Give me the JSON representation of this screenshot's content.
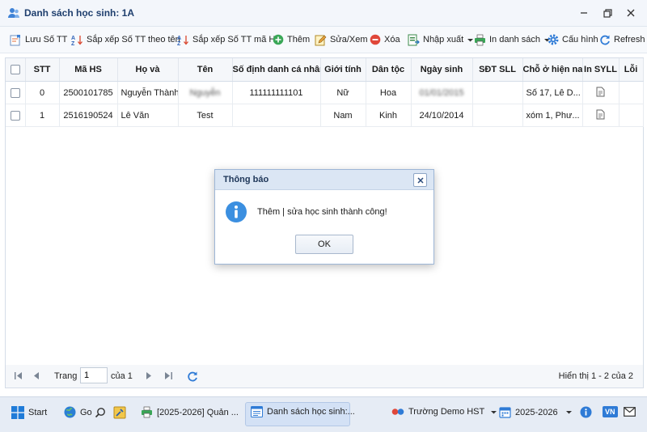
{
  "window": {
    "title": "Danh sách học sinh: 1A"
  },
  "toolbar": {
    "save_order": "Lưu Số TT",
    "sort_by_name": "Sắp xếp Số TT theo tên",
    "sort_by_code": "Sắp xếp Số TT mã HS",
    "add": "Thêm",
    "edit_view": "Sửa/Xem",
    "delete": "Xóa",
    "import_export": "Nhập xuất",
    "print_list": "In danh sách",
    "config": "Cấu hình",
    "refresh": "Refresh"
  },
  "grid": {
    "columns": [
      "STT",
      "Mã HS",
      "Họ và",
      "Tên",
      "Số định danh cá nhân",
      "Giới tính",
      "Dân tộc",
      "Ngày sinh",
      "SĐT SLL",
      "Chỗ ở hiện nay",
      "In SYLL",
      "Lỗi"
    ],
    "rows": [
      {
        "stt": "0",
        "ma_hs": "2500101785",
        "ho": "Nguyễn Thành",
        "ten": "Nguyễn",
        "so_dinh_danh": "111111111101",
        "gioi_tinh": "Nữ",
        "dan_toc": "Hoa",
        "ngay_sinh": "01/01/2015",
        "sdt": "",
        "cho_o": "Số 17, Lê D...",
        "loi": ""
      },
      {
        "stt": "1",
        "ma_hs": "2516190524",
        "ho": "Lê Văn",
        "ten": "Test",
        "so_dinh_danh": "",
        "gioi_tinh": "Nam",
        "dan_toc": "Kinh",
        "ngay_sinh": "24/10/2014",
        "sdt": "",
        "cho_o": "xóm 1, Phư...",
        "loi": ""
      }
    ]
  },
  "pager": {
    "page_label": "Trang",
    "page_value": "1",
    "of_label": "của 1",
    "summary": "Hiển thị 1 - 2 của 2"
  },
  "dialog": {
    "title": "Thông báo",
    "message": "Thêm | sửa học sinh thành công!",
    "ok": "OK"
  },
  "taskbar": {
    "start": "Start",
    "go": "Go",
    "app1": "[2025-2026] Quản ...",
    "app2": "Danh sách học sinh:...",
    "school": "Trường Demo HST",
    "year": "2025-2026",
    "lang": "VN"
  },
  "colors": {
    "accent": "#2f7bd6",
    "add_green": "#3aa757",
    "delete_red": "#e0473a",
    "title_text": "#1f3f6e"
  }
}
